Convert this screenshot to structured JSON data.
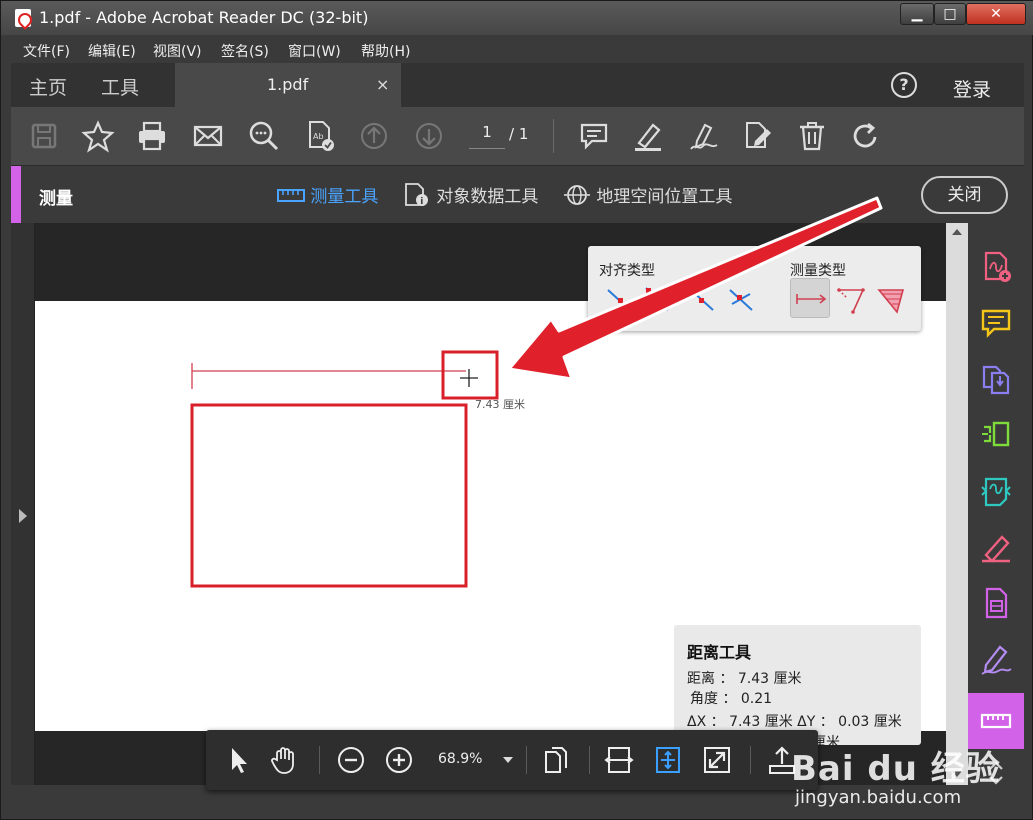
{
  "window": {
    "title": "1.pdf - Adobe Acrobat Reader DC (32-bit)"
  },
  "menu": [
    "文件(F)",
    "编辑(E)",
    "视图(V)",
    "签名(S)",
    "窗口(W)",
    "帮助(H)"
  ],
  "tabs": {
    "home": "主页",
    "tools": "工具",
    "document": "1.pdf",
    "close": "×",
    "help": "?",
    "login": "登录"
  },
  "toolbar": {
    "page_current": "1",
    "page_total": "/ 1"
  },
  "measure_bar": {
    "title": "测量",
    "tools": [
      "测量工具",
      "对象数据工具",
      "地理空间位置工具"
    ],
    "close": "关闭"
  },
  "measure_options": {
    "snap_title": "对齐类型",
    "measure_title": "测量类型"
  },
  "document": {
    "measure_label": "7.43 厘米"
  },
  "distance_panel": {
    "title": "距离工具",
    "distance": "距离 ： 7.43 厘米",
    "angle": "角度 ： 0.21",
    "delta": "ΔX ： 7.43 厘米    ΔY ： 0.03 厘米",
    "extra": "厘米"
  },
  "floatbar": {
    "zoom": "68.9%"
  },
  "watermark": {
    "logo": "Bai du 经验",
    "url": "jingyan.baidu.com"
  },
  "colors": {
    "accent": "#d263e8",
    "active_tool": "#4aa3ff",
    "annotation_red": "#e0202a"
  }
}
